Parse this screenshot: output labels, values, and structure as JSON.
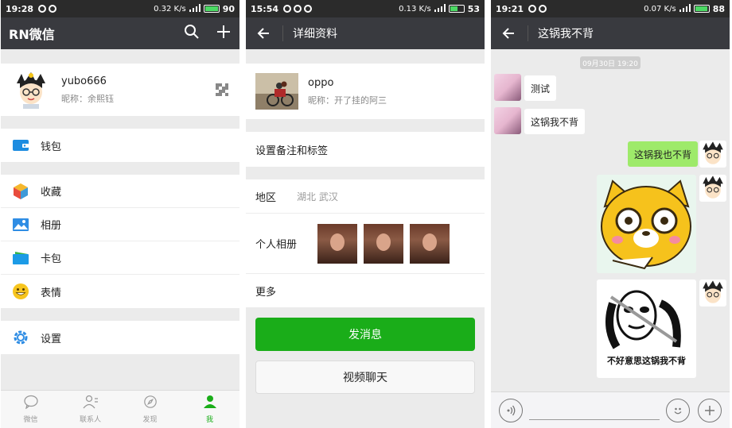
{
  "phones": [
    {
      "status": {
        "time": "19:28",
        "speed": "0.32 K/s",
        "battery": "90",
        "battery_level": 0.9
      },
      "title": "RN微信",
      "profile": {
        "name": "yubo666",
        "nickname": "昵称：余熙钰"
      },
      "menu": {
        "wallet": "钱包",
        "favorites": "收藏",
        "album": "相册",
        "cards": "卡包",
        "stickers": "表情",
        "settings": "设置"
      },
      "tabs": [
        {
          "label": "微信",
          "icon": "chat-icon"
        },
        {
          "label": "联系人",
          "icon": "contacts-icon"
        },
        {
          "label": "发现",
          "icon": "discover-icon"
        },
        {
          "label": "我",
          "icon": "me-icon"
        }
      ]
    },
    {
      "status": {
        "time": "15:54",
        "speed": "0.13 K/s",
        "battery": "53",
        "battery_level": 0.53
      },
      "title": "详细资料",
      "contact": {
        "name": "oppo",
        "nickname": "昵称：开了挂的阿三"
      },
      "remark": "设置备注和标签",
      "region_label": "地区",
      "region_value": "湖北 武汉",
      "album_label": "个人相册",
      "more_label": "更多",
      "send_message": "发消息",
      "video_chat": "视频聊天"
    },
    {
      "status": {
        "time": "19:21",
        "speed": "0.07 K/s",
        "battery": "88",
        "battery_level": 0.88
      },
      "title": "这锅我不背",
      "timestamp": "09月30日 19:20",
      "messages": [
        {
          "from": "other",
          "text": "测试"
        },
        {
          "from": "other",
          "text": "这锅我不背"
        },
        {
          "from": "me",
          "text": "这锅我也不背"
        }
      ],
      "sticker_caption": "不好意思这锅我不背"
    }
  ],
  "colors": {
    "accent": "#1aad19",
    "titlebar": "#393a3f",
    "bubble_me": "#9eea6a"
  }
}
